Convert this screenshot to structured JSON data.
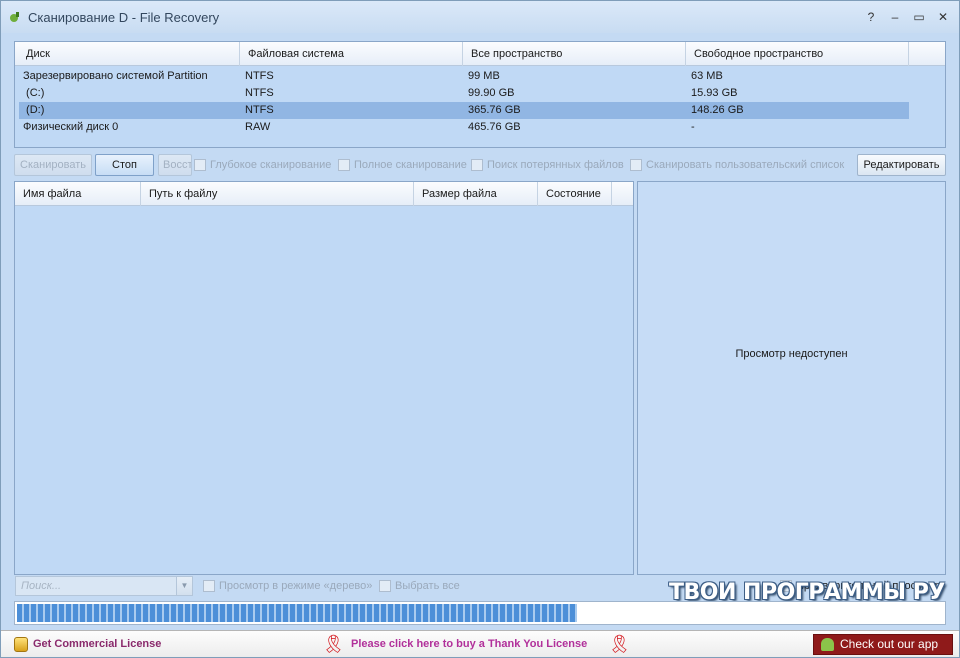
{
  "window": {
    "title": "Сканирование D - File Recovery"
  },
  "titlebar_buttons": {
    "help": "?",
    "minimize": "–",
    "maximize": "▭",
    "close": "✕"
  },
  "disks": {
    "columns": [
      "Диск",
      "Файловая система",
      "Все пространство",
      "Свободное пространство"
    ],
    "rows": [
      {
        "disk": "Зарезервировано системой Partition",
        "fs": "NTFS",
        "total": "99 MB",
        "free": "63 MB"
      },
      {
        "disk": " (C:)",
        "fs": "NTFS",
        "total": "99.90 GB",
        "free": "15.93 GB"
      },
      {
        "disk": " (D:)",
        "fs": "NTFS",
        "total": "365.76 GB",
        "free": "148.26 GB",
        "selected": true
      },
      {
        "disk": "Физический диск 0",
        "fs": "RAW",
        "total": "465.76 GB",
        "free": "-"
      }
    ]
  },
  "toolbar": {
    "scan": "Сканировать",
    "stop": "Стоп",
    "restore": "Восст",
    "deep_scan": "Глубокое сканирование",
    "full_scan": "Полное сканирование",
    "lost_files": "Поиск потерянных файлов",
    "custom_list": "Сканировать пользовательский список",
    "edit": "Редактировать"
  },
  "files": {
    "columns": [
      "Имя файла",
      "Путь к файлу",
      "Размер файла",
      "Состояние"
    ]
  },
  "preview": {
    "message": "Просмотр недоступен",
    "checkbox_label": "Предварительный просмотр",
    "checked": true
  },
  "bottom": {
    "search_placeholder": "Поиск...",
    "tree_view": "Просмотр в режиме «дерево»",
    "select_all": "Выбрать все",
    "watermark": "ТВОИ ПРОГРАММЫ РУ"
  },
  "progress": {
    "fraction": 0.605
  },
  "footer": {
    "license": "Get Commercial License",
    "thank_you": "Please click here to buy a Thank You License",
    "app": "Check out our app"
  }
}
